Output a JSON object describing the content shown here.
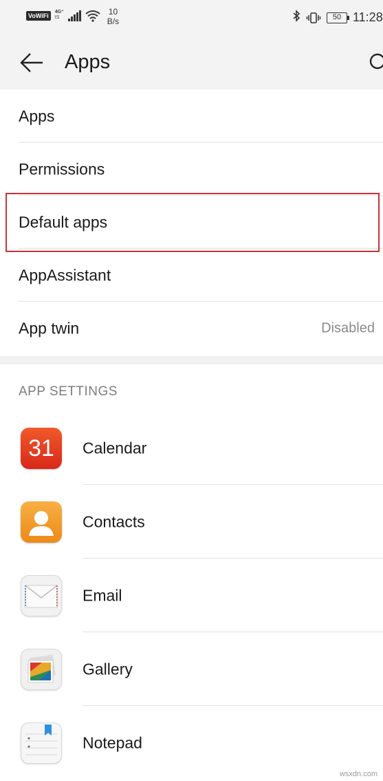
{
  "status_bar": {
    "vowifi": "VoWiFi",
    "network_type": "4G⁺",
    "network_sub": "IS",
    "speed_value": "10",
    "speed_unit": "B/s",
    "battery": "50",
    "time": "11:28"
  },
  "header": {
    "title": "Apps"
  },
  "menu": {
    "items": [
      {
        "label": "Apps",
        "value": ""
      },
      {
        "label": "Permissions",
        "value": ""
      },
      {
        "label": "Default apps",
        "value": ""
      },
      {
        "label": "AppAssistant",
        "value": ""
      },
      {
        "label": "App twin",
        "value": "Disabled"
      }
    ]
  },
  "app_settings": {
    "header": "APP SETTINGS",
    "apps": [
      {
        "name": "Calendar",
        "icon": "calendar-icon",
        "icon_text": "31"
      },
      {
        "name": "Contacts",
        "icon": "contacts-icon"
      },
      {
        "name": "Email",
        "icon": "email-icon"
      },
      {
        "name": "Gallery",
        "icon": "gallery-icon"
      },
      {
        "name": "Notepad",
        "icon": "notepad-icon"
      }
    ]
  },
  "watermark": "wsxdn.com",
  "colors": {
    "highlight": "#c8323a",
    "header_bg": "#f3f3f3",
    "calendar": "#e2391f",
    "contacts": "#f29a27"
  }
}
